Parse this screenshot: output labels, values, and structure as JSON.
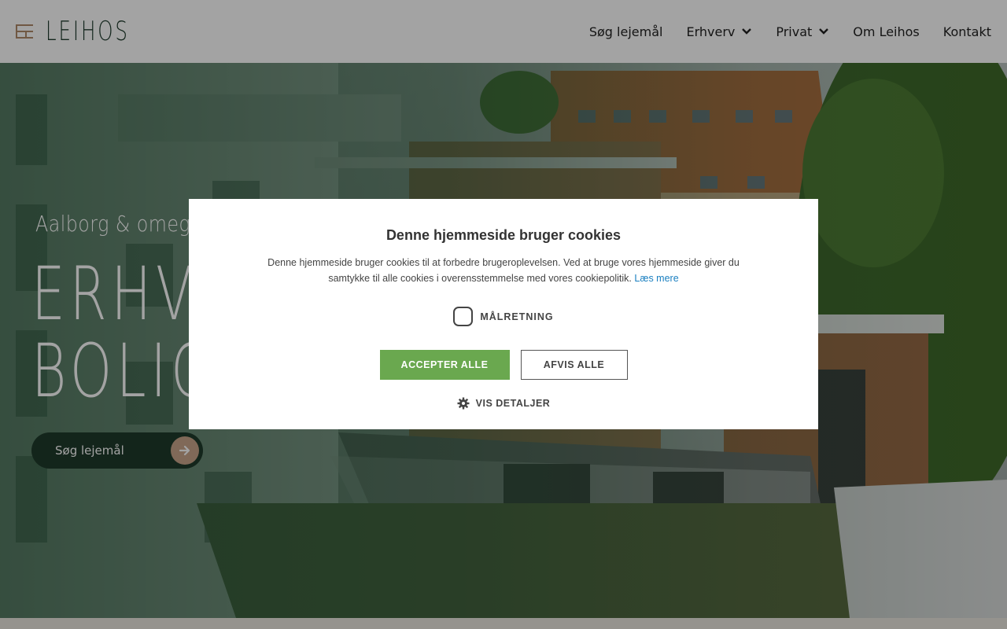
{
  "header": {
    "logo_text": "LEIHOS",
    "nav": [
      {
        "label": "Søg lejemål",
        "has_dropdown": false
      },
      {
        "label": "Erhverv",
        "has_dropdown": true
      },
      {
        "label": "Privat",
        "has_dropdown": true
      },
      {
        "label": "Om Leihos",
        "has_dropdown": false
      },
      {
        "label": "Kontakt",
        "has_dropdown": false
      }
    ]
  },
  "hero": {
    "subtitle": "Aalborg & omegn",
    "title_line1": "ERHVERV",
    "title_line2": "BOLIG",
    "button_label": "Søg lejemål",
    "button_icon": "arrow-right-icon"
  },
  "cookie_dialog": {
    "title": "Denne hjemmeside bruger cookies",
    "body": "Denne hjemmeside bruger cookies til at forbedre brugeroplevelsen. Ved at bruge vores hjemmeside giver du samtykke til alle cookies i overensstemmelse med vores cookiepolitik.",
    "link": "Læs mere",
    "checkbox_label": "MÅLRETNING",
    "checkbox_checked": false,
    "accept_label": "ACCEPTER ALLE",
    "decline_label": "AFVIS ALLE",
    "details_label": "VIS DETALJER",
    "details_icon": "gear-icon"
  },
  "colors": {
    "brand_green": "#1f3a2b",
    "accent_tan": "#c9a58a",
    "accept_green": "#6aa84f",
    "link_blue": "#1a7fc0"
  }
}
